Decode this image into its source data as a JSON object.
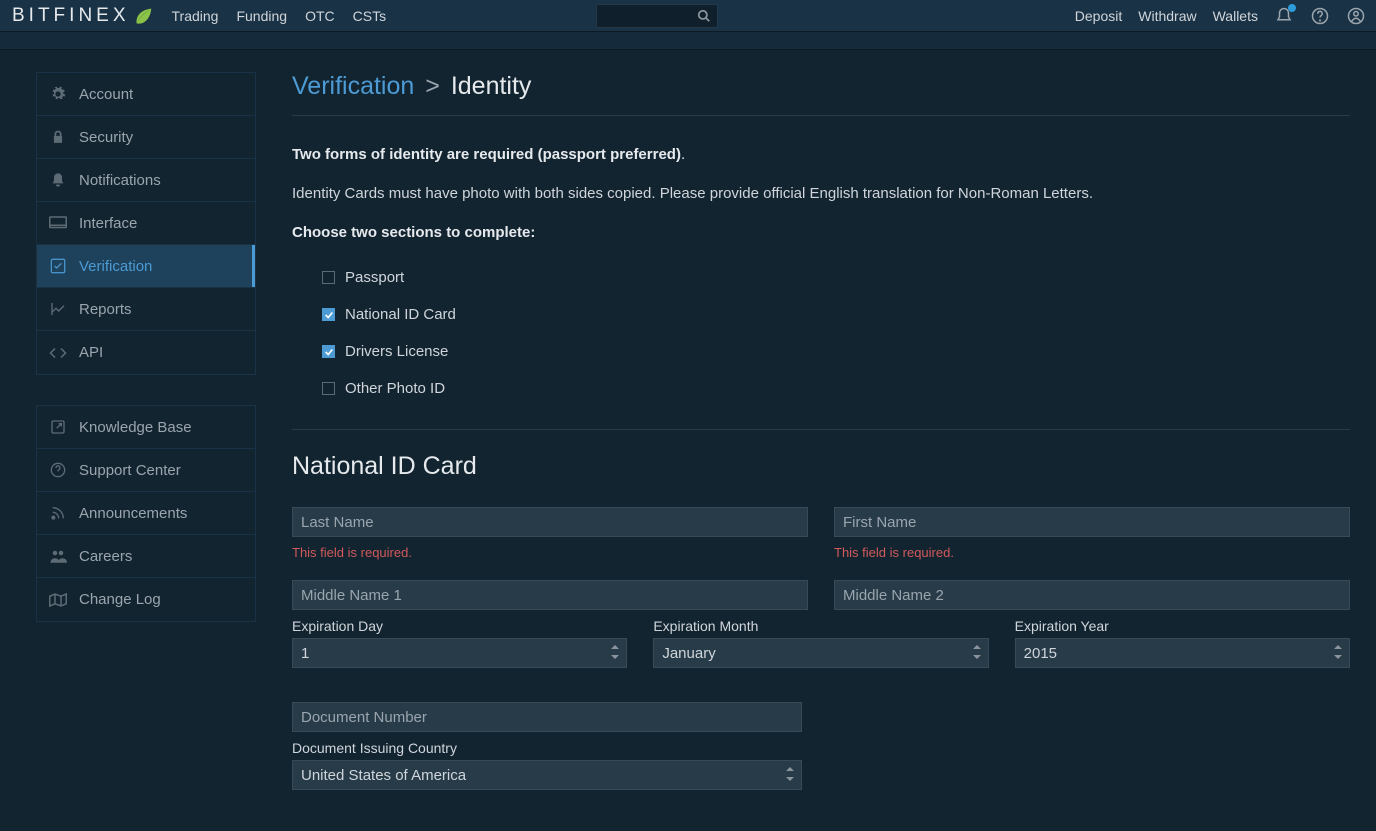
{
  "brand": "BITFINEX",
  "topnav": {
    "links": [
      "Trading",
      "Funding",
      "OTC",
      "CSTs"
    ],
    "right": [
      "Deposit",
      "Withdraw",
      "Wallets"
    ]
  },
  "sidebar": {
    "primary": [
      {
        "label": "Account"
      },
      {
        "label": "Security"
      },
      {
        "label": "Notifications"
      },
      {
        "label": "Interface"
      },
      {
        "label": "Verification"
      },
      {
        "label": "Reports"
      },
      {
        "label": "API"
      }
    ],
    "secondary": [
      {
        "label": "Knowledge Base"
      },
      {
        "label": "Support Center"
      },
      {
        "label": "Announcements"
      },
      {
        "label": "Careers"
      },
      {
        "label": "Change Log"
      }
    ]
  },
  "breadcrumb": {
    "root": "Verification",
    "current": "Identity"
  },
  "intro": {
    "line1": "Two forms of identity are required (passport preferred)",
    "line2": "Identity Cards must have photo with both sides copied. Please provide official English translation for Non-Roman Letters.",
    "line3": "Choose two sections to complete:"
  },
  "id_options": [
    {
      "label": "Passport",
      "checked": false
    },
    {
      "label": "National ID Card",
      "checked": true
    },
    {
      "label": "Drivers License",
      "checked": true
    },
    {
      "label": "Other Photo ID",
      "checked": false
    }
  ],
  "section_title": "National ID Card",
  "fields": {
    "last_name": {
      "placeholder": "Last Name",
      "error": "This field is required."
    },
    "first_name": {
      "placeholder": "First Name",
      "error": "This field is required."
    },
    "middle1": {
      "placeholder": "Middle Name 1"
    },
    "middle2": {
      "placeholder": "Middle Name 2"
    },
    "exp_day": {
      "label": "Expiration Day",
      "value": "1"
    },
    "exp_month": {
      "label": "Expiration Month",
      "value": "January"
    },
    "exp_year": {
      "label": "Expiration Year",
      "value": "2015"
    },
    "doc_number": {
      "placeholder": "Document Number"
    },
    "doc_country": {
      "label": "Document Issuing Country",
      "value": "United States of America"
    }
  }
}
